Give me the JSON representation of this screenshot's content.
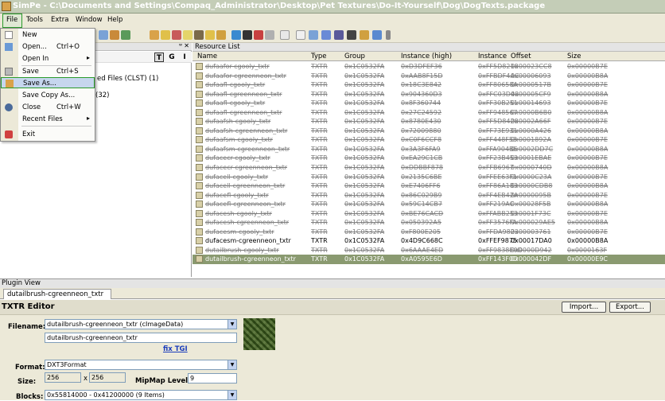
{
  "window": {
    "title": "SimPe - C:\\Documents and Settings\\Compaq_Administrator\\Desktop\\Pet Textures\\Do-It-Yourself\\Dog\\DogTexts.package"
  },
  "menubar": [
    "File",
    "Tools",
    "Extra",
    "Window",
    "Help"
  ],
  "file_menu": [
    {
      "label": "New",
      "shortcut": "",
      "arrow": false
    },
    {
      "label": "Open...",
      "shortcut": "Ctrl+O",
      "arrow": false
    },
    {
      "label": "Open In",
      "shortcut": "",
      "arrow": true
    },
    {
      "label": "Save",
      "shortcut": "Ctrl+S",
      "arrow": false
    },
    {
      "label": "Save As...",
      "shortcut": "",
      "arrow": false
    },
    {
      "label": "Save Copy As...",
      "shortcut": "",
      "arrow": false
    },
    {
      "label": "Close",
      "shortcut": "Ctrl+W",
      "arrow": false
    },
    {
      "label": "Recent Files",
      "shortcut": "",
      "arrow": true
    },
    {
      "label": "Exit",
      "shortcut": "",
      "arrow": false
    }
  ],
  "left_panel": {
    "toolbuttons": [
      "T",
      "G",
      "I"
    ],
    "rows": [
      "ed Files (CLST) (1)",
      "(32)"
    ]
  },
  "resource_list": {
    "header": "Resource List",
    "columns": [
      "Name",
      "Type",
      "Group",
      "Instance (high)",
      "Instance",
      "Offset",
      "Size"
    ],
    "rows": [
      {
        "name": "dufaafor-cgooly_txtr",
        "type": "TXTR",
        "group": "0x1C0532FA",
        "ihigh": "0xD3DFEF36",
        "inst": "0xFF5D8218",
        "offset": "0x00023CC8",
        "size": "0x00000B7E",
        "state": "del"
      },
      {
        "name": "dufaafor-cgreenneon_txtr",
        "type": "TXTR",
        "group": "0x1C0532FA",
        "ihigh": "0xAAB8F15D",
        "inst": "0xFFBDF4AC",
        "offset": "0x00006093",
        "size": "0x00000B8A",
        "state": "del"
      },
      {
        "name": "dufaafl-cgooly_txtr",
        "type": "TXTR",
        "group": "0x1C0532FA",
        "ihigh": "0x18C3E842",
        "inst": "0xFF80658A",
        "offset": "0x0000517B",
        "size": "0x00000B7E",
        "state": "del"
      },
      {
        "name": "dufaafl-cgreenneon_txtr",
        "type": "TXTR",
        "group": "0x1C0532FA",
        "ihigh": "0x904360D3",
        "inst": "0xFFC03D48",
        "offset": "0x00005CF9",
        "size": "0x00000B8A",
        "state": "del"
      },
      {
        "name": "dufaafl-cgooly_txtr",
        "type": "TXTR",
        "group": "0x1C0532FA",
        "ihigh": "0x8F360744",
        "inst": "0xFF30B251",
        "offset": "0x00014693",
        "size": "0x00000B7E",
        "state": "del"
      },
      {
        "name": "dufaafl-cgreenneon_txtr",
        "type": "TXTR",
        "group": "0x1C0532FA",
        "ihigh": "0x27C24592",
        "inst": "0xFF948567",
        "offset": "0x0000B6B0",
        "size": "0x00000B8A",
        "state": "del"
      },
      {
        "name": "dufaafsh-cgooly_txtr",
        "type": "TXTR",
        "group": "0x1C0532FA",
        "ihigh": "0x8780E430",
        "inst": "0xFF5D8428",
        "offset": "0x0002A66F",
        "size": "0x00000B7E",
        "state": "del"
      },
      {
        "name": "dufaafsh-cgreenneon_txtr",
        "type": "TXTR",
        "group": "0x1C0532FA",
        "ihigh": "0x72009880",
        "inst": "0xFF73E931",
        "offset": "0x0000A426",
        "size": "0x00000B8A",
        "state": "del"
      },
      {
        "name": "dufaafsm-cgooly_txtr",
        "type": "TXTR",
        "group": "0x1C0532FA",
        "ihigh": "0xC0F6CCF8",
        "inst": "0xFF448F58",
        "offset": "0x0001892A",
        "size": "0x00000B7E",
        "state": "del"
      },
      {
        "name": "dufaafsm-cgreenneon_txtr",
        "type": "TXTR",
        "group": "0x1C0532FA",
        "ihigh": "0x3A3F6FA9",
        "inst": "0xFFA904BE",
        "offset": "0x0002DD7C",
        "size": "0x00000B8A",
        "state": "del"
      },
      {
        "name": "dufacecr-cgooly_txtr",
        "type": "TXTR",
        "group": "0x1C0532FA",
        "ihigh": "0xEA29C1CB",
        "inst": "0xFF23B453",
        "offset": "0x0001EBAE",
        "size": "0x00000B7E",
        "state": "del"
      },
      {
        "name": "dufacecr-cgreenneon_txtr",
        "type": "TXTR",
        "group": "0x1C0532FA",
        "ihigh": "0xDDBBF878",
        "inst": "0xFFB6967",
        "offset": "0x0000740D",
        "size": "0x00000B8A",
        "state": "del"
      },
      {
        "name": "dufacell-cgooly_txtr",
        "type": "TXTR",
        "group": "0x1C0532FA",
        "ihigh": "0x2135C6BE",
        "inst": "0xFFEE63F1",
        "offset": "0x0000C23A",
        "size": "0x00000B7E",
        "state": "del"
      },
      {
        "name": "dufacell-cgreenneon_txtr",
        "type": "TXTR",
        "group": "0x1C0532FA",
        "ihigh": "0xE7406FF6",
        "inst": "0xFF86A183",
        "offset": "0x0000CDB8",
        "size": "0x00000B8A",
        "state": "del"
      },
      {
        "name": "dufacefl-cgooly_txtr",
        "type": "TXTR",
        "group": "0x1C0532FA",
        "ihigh": "0x86C029B9",
        "inst": "0xFF4EB42A",
        "offset": "0x0000095B",
        "size": "0x00000B7E",
        "state": "del"
      },
      {
        "name": "dufacefl-cgreenneon_txtr",
        "type": "TXTR",
        "group": "0x1C0532FA",
        "ihigh": "0x59C14CB7",
        "inst": "0xFF219AC",
        "offset": "0x00028F5B",
        "size": "0x00000B8A",
        "state": "del"
      },
      {
        "name": "dufacesh-cgooly_txtr",
        "type": "TXTR",
        "group": "0x1C0532FA",
        "ihigh": "0xBE76CACD",
        "inst": "0xFFABB253",
        "offset": "0x0001F73C",
        "size": "0x00000B7E",
        "state": "del"
      },
      {
        "name": "dufacesh-cgreenneon_txtr",
        "type": "TXTR",
        "group": "0x1C0532FA",
        "ihigh": "0x050392A5",
        "inst": "0xFF3576FA",
        "offset": "0x000029AE5",
        "size": "0x00000B8A",
        "state": "del"
      },
      {
        "name": "dufacesm-cgooly_txtr",
        "type": "TXTR",
        "group": "0x1C0532FA",
        "ihigh": "0xF800E205",
        "inst": "0xFFDA9823",
        "offset": "0x00003761",
        "size": "0x00000B7E",
        "state": "del"
      },
      {
        "name": "dufacesm-cgreenneon_txtr",
        "type": "TXTR",
        "group": "0x1C0532FA",
        "ihigh": "0x4D9C668C",
        "inst": "0xFFEF9875",
        "offset": "0x00017DA0",
        "size": "0x00000B8A",
        "state": "norm"
      },
      {
        "name": "dutailbrush-cgooly_txtr",
        "type": "TXTR",
        "group": "0x1C0532FA",
        "ihigh": "0x6AAAE4ED",
        "inst": "0xFF9838E0D",
        "offset": "0x0000D942",
        "size": "0x0000163F",
        "state": "del"
      },
      {
        "name": "dutailbrush-cgreenneon_txtr",
        "type": "TXTR",
        "group": "0x1C0532FA",
        "ihigh": "0xA0595E6D",
        "inst": "0xFF143F0D",
        "offset": "0x000042DF",
        "size": "0x00000E9C",
        "state": "sel"
      }
    ]
  },
  "plugin_view": {
    "header": "Plugin View",
    "tab": "dutailbrush-cgreenneon_txtr",
    "editor_title": "TXTR Editor",
    "import_label": "Import...",
    "export_label": "Export...",
    "filename_label": "Filename:",
    "filename_combo": "dutailbrush-cgreenneon_txtr (cImageData)",
    "filename_text": "dutailbrush-cgreenneon_txtr",
    "fix_tgi": "fix TGI",
    "format_label": "Format:",
    "format_value": "DXT3Format",
    "size_label": "Size:",
    "size_w": "256",
    "size_x": "x",
    "size_h": "256",
    "mipmap_label": "MipMap Level:",
    "mipmap_value": "9",
    "blocks_label": "Blocks:",
    "blocks_value": "0x55814000 - 0x41200000 (9 Items)"
  }
}
